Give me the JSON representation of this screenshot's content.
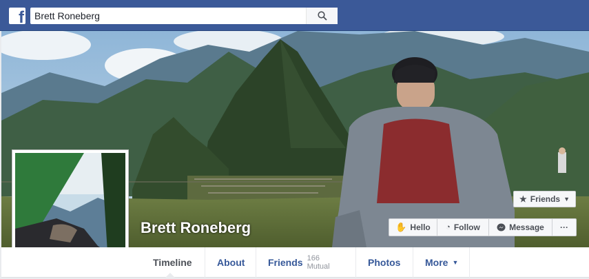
{
  "topbar": {
    "logo_letter": "f",
    "search_value": "Brett Roneberg",
    "search_icon": "magnifier-icon"
  },
  "profile": {
    "name": "Brett Roneberg"
  },
  "actions": {
    "friends_label": "Friends",
    "hello_label": "Hello",
    "follow_label": "Follow",
    "message_label": "Message",
    "more_label": "···"
  },
  "nav": {
    "timeline": "Timeline",
    "about": "About",
    "friends": "Friends",
    "friends_mutual": "166 Mutual",
    "photos": "Photos",
    "more": "More"
  },
  "colors": {
    "brand": "#3b5998",
    "link": "#365899"
  }
}
